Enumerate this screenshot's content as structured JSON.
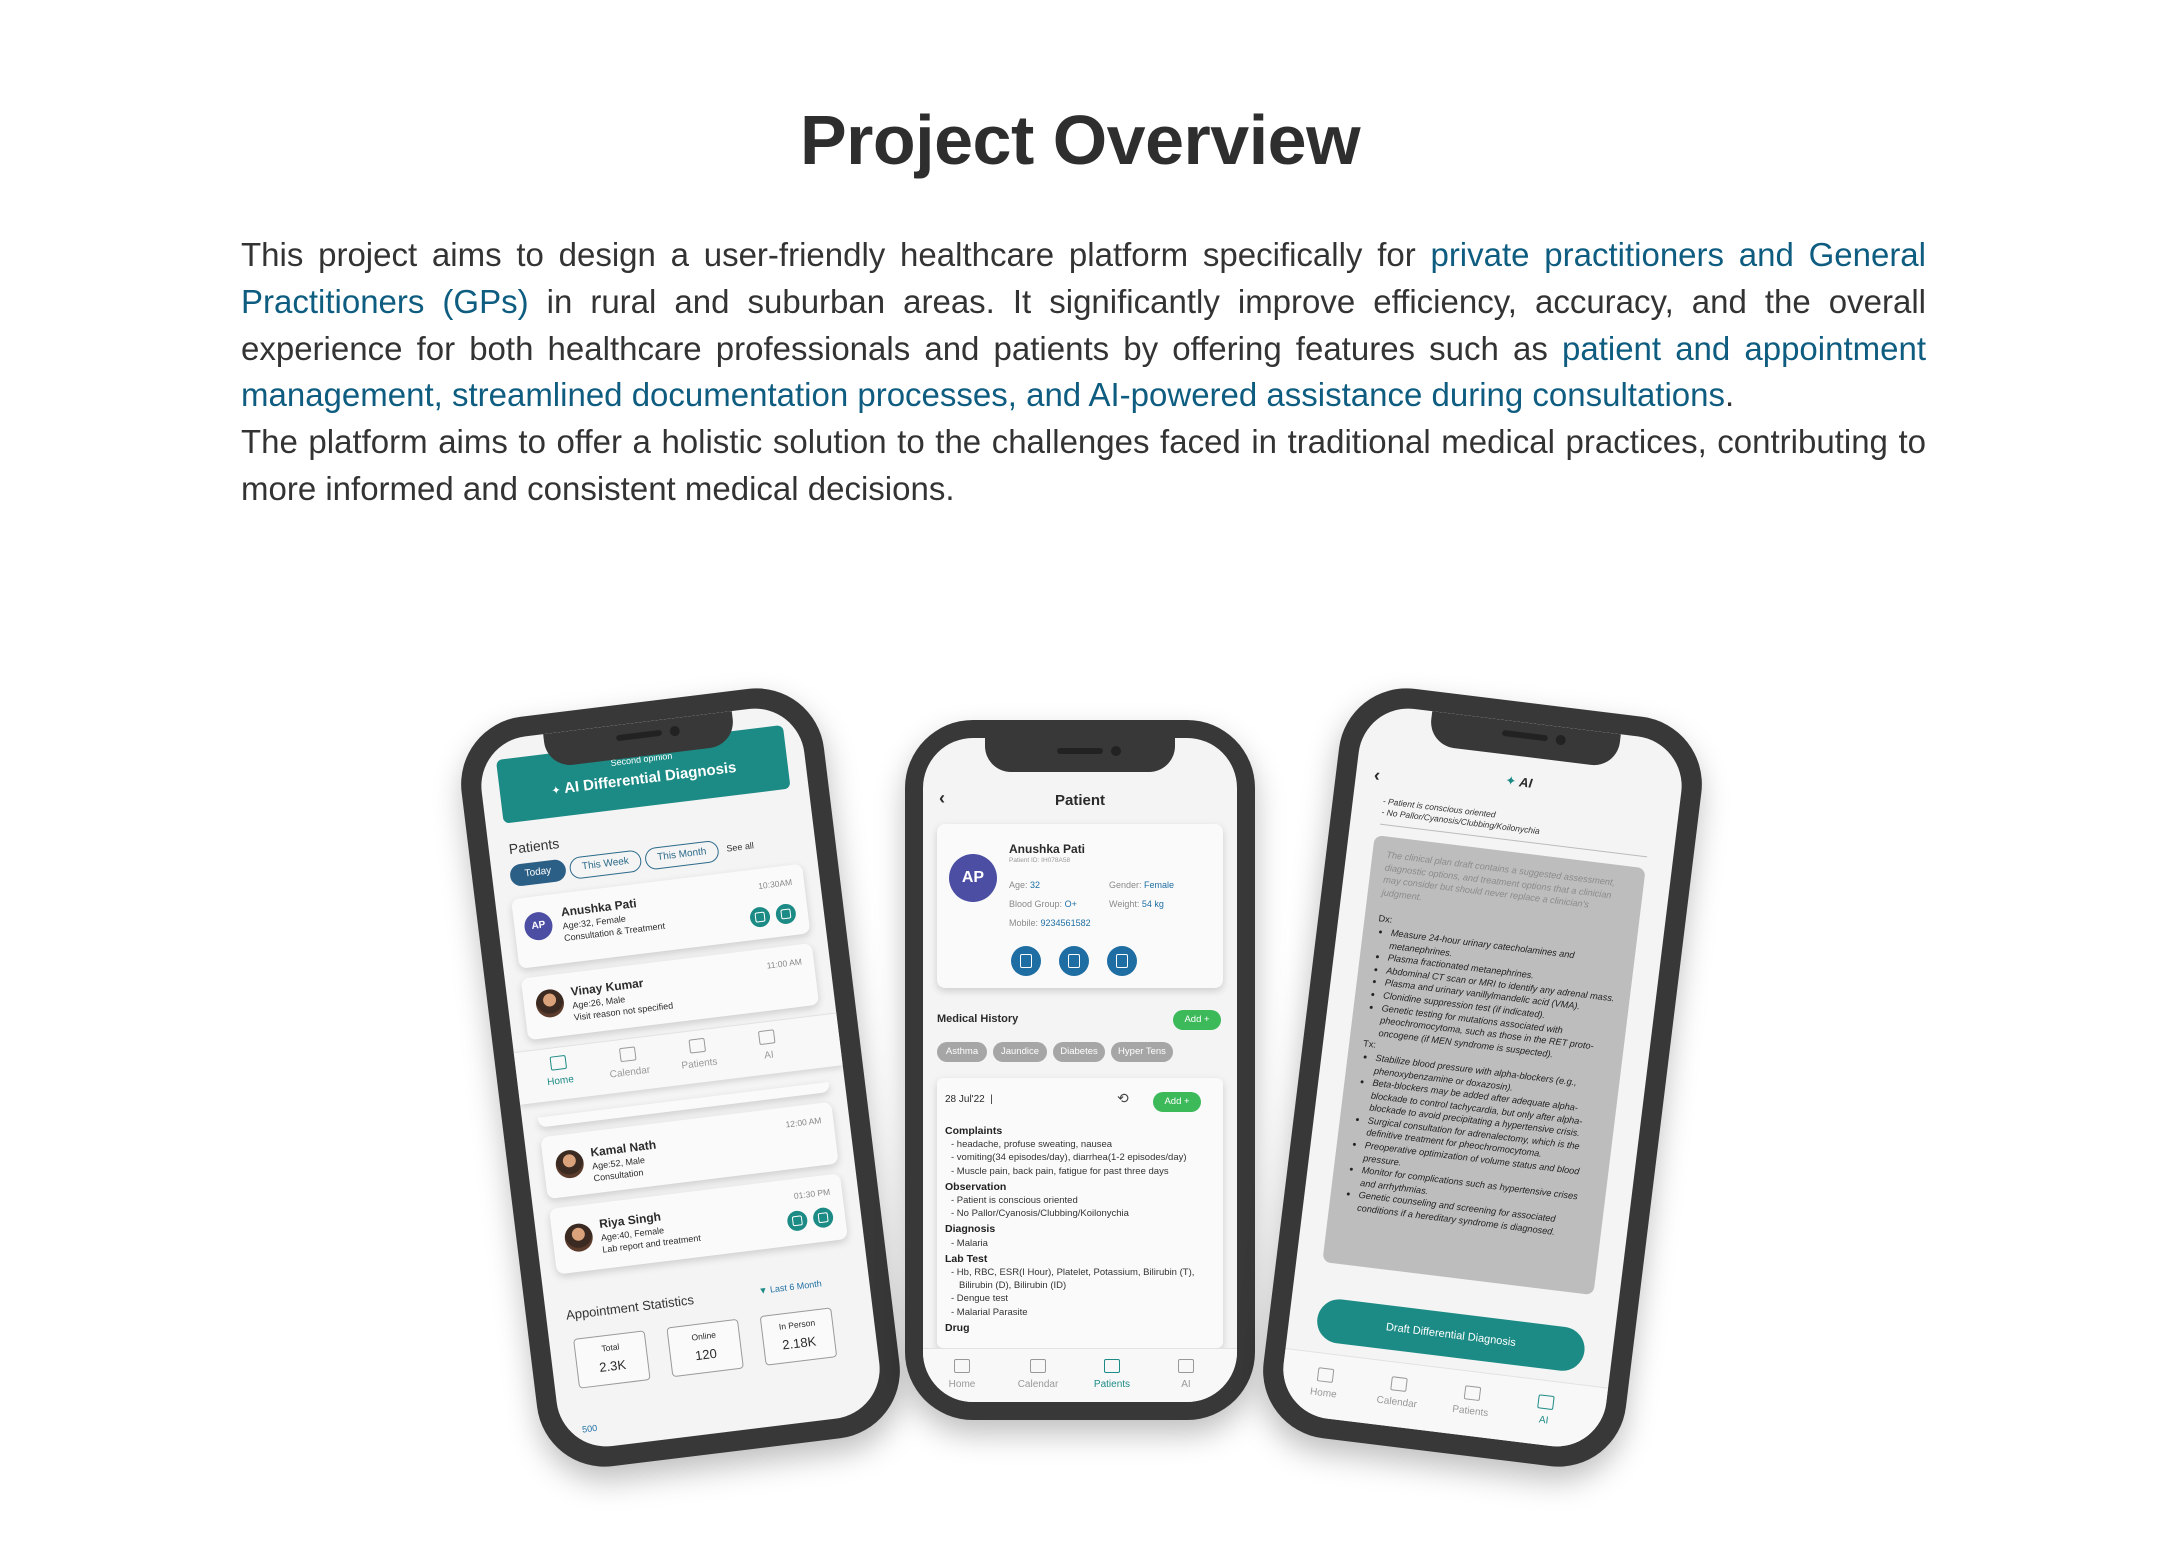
{
  "page": {
    "title": "Project Overview",
    "overview": {
      "p1_a": "This project aims to design a user-friendly healthcare platform specifically for ",
      "p1_hl1": "private practitioners and General Practitioners (GPs)",
      "p1_b": " in rural and suburban areas. It significantly improve efficiency, accuracy, and the overall experience for both healthcare professionals and patients by offering features such as ",
      "p1_hl2": "patient and appointment management, streamlined documentation processes, and AI-powered assistance during consultations",
      "p1_c": ".",
      "p2": "The platform aims to offer a holistic solution to the challenges faced in traditional medical practices, contributing to more informed and consistent medical decisions."
    },
    "colors": {
      "teal": "#1d8b85",
      "link": "#0e5d80",
      "phone_frame": "#383838"
    }
  },
  "home_screen": {
    "banner_small": "Second opinion",
    "banner_title": "AI Differential Diagnosis",
    "patients_label": "Patients",
    "filters": [
      "Today",
      "This Week",
      "This Month"
    ],
    "see_all": "See all",
    "appointments": [
      {
        "initials": "AP",
        "name": "Anushka Pati",
        "time": "10:30AM",
        "info": "Age:32, Female",
        "reason": "Consultation & Treatment"
      },
      {
        "name": "Vinay Kumar",
        "time": "11:00 AM",
        "info": "Age:26, Male",
        "reason": "Visit reason not specified"
      },
      {
        "name": "Kamal Nath",
        "time": "12:00 AM",
        "info": "Age:52, Male",
        "reason": "Consultation"
      },
      {
        "name": "Riya Singh",
        "time": "01:30 PM",
        "info": "Age:40, Female",
        "reason": "Lab report and treatment"
      }
    ],
    "nav": [
      "Home",
      "Calendar",
      "Patients",
      "AI"
    ],
    "stats_title": "Appointment Statistics",
    "stats_range": "Last 6 Month",
    "stats": [
      {
        "label": "Total",
        "value": "2.3K"
      },
      {
        "label": "Online",
        "value": "120"
      },
      {
        "label": "In Person",
        "value": "2.18K"
      }
    ],
    "chart_axis_value": "500"
  },
  "patient_screen": {
    "header": "Patient",
    "initials": "AP",
    "name": "Anushka Pati",
    "patient_id": "Patient ID: IH078A58",
    "age_label": "Age:",
    "age": "32",
    "gender_label": "Gender:",
    "gender": "Female",
    "blood_label": "Blood Group:",
    "blood": "O+",
    "weight_label": "Weight:",
    "weight": "54 kg",
    "mobile_label": "Mobile:",
    "mobile": "9234561582",
    "medical_history": "Medical History",
    "add": "Add +",
    "tags": [
      "Asthma",
      "Jaundice",
      "Diabetes",
      "Hyper Tens"
    ],
    "date": "28 Jul'22",
    "complaints_h": "Complaints",
    "complaints": [
      "- headache, profuse sweating, nausea",
      "- vomiting(34 episodes/day), diarrhea(1-2 episodes/day)",
      "- Muscle pain, back pain, fatigue for past three days"
    ],
    "observation_h": "Observation",
    "observation": [
      "- Patient is conscious oriented",
      "- No Pallor/Cyanosis/Clubbing/Koilonychia"
    ],
    "diagnosis_h": "Diagnosis",
    "diagnosis": [
      "- Malaria"
    ],
    "lab_h": "Lab Test",
    "lab": [
      "- Hb, RBC, ESR(I Hour), Platelet, Potassium, Bilirubin (T),",
      "Bilirubin (D), Bilirubin (ID)",
      "- Dengue test",
      "- Malarial Parasite"
    ],
    "drug_h": "Drug",
    "nav": [
      "Home",
      "Calendar",
      "Patients",
      "AI"
    ]
  },
  "ai_screen": {
    "header": "AI",
    "obs": [
      "- Patient is conscious oriented",
      "- No Pallor/Cyanosis/Clubbing/Koilonychia"
    ],
    "disclaimer": "The clinical plan draft contains a suggested assessment, diagnostic options, and treatment options that a clinician may consider but should never replace a clinician's judgment.",
    "dx_label": "Dx:",
    "dx": [
      "Measure 24-hour urinary catecholamines and metanephrines.",
      "Plasma fractionated metanephrines.",
      "Abdominal CT scan or MRI to identify any adrenal mass.",
      "Plasma and urinary vanillylmandelic acid (VMA).",
      "Clonidine suppression test (if indicated).",
      "Genetic testing for mutations associated with pheochromocytoma, such as those in the RET proto-oncogene (if MEN syndrome is suspected)."
    ],
    "tx_label": "Tx:",
    "tx": [
      "Stabilize blood pressure with alpha-blockers (e.g., phenoxybenzamine or doxazosin).",
      "Beta-blockers may be added after adequate alpha-blockade to control tachycardia, but only after alpha-blockade to avoid precipitating a hypertensive crisis.",
      "Surgical consultation for adrenalectomy, which is the definitive treatment for pheochromocytoma.",
      "Preoperative optimization of volume status and blood pressure.",
      "Monitor for complications such as hypertensive crises and arrhythmias.",
      "Genetic counseling and screening for associated conditions if a hereditary syndrome is diagnosed."
    ],
    "button": "Draft Differential Diagnosis",
    "nav": [
      "Home",
      "Calendar",
      "Patients",
      "AI"
    ]
  }
}
